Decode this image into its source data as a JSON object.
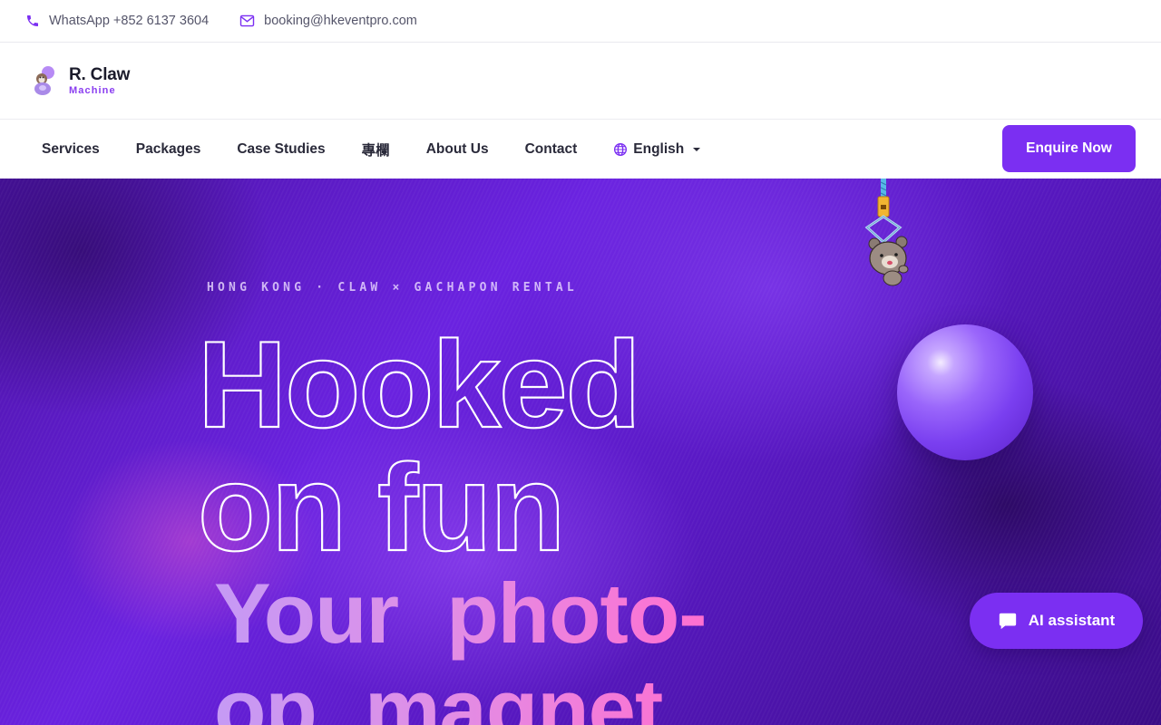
{
  "topbar": {
    "whatsapp": "WhatsApp +852 6137 3604",
    "email": "booking@hkeventpro.com"
  },
  "brand": {
    "name": "R. Claw",
    "sub": "Machine"
  },
  "nav": {
    "items": [
      {
        "label": "Services"
      },
      {
        "label": "Packages"
      },
      {
        "label": "Case Studies"
      },
      {
        "label": "專欄"
      },
      {
        "label": "About Us"
      },
      {
        "label": "Contact"
      }
    ],
    "language": "English",
    "cta": "Enquire Now"
  },
  "hero": {
    "eyebrow": "HONG KONG · CLAW × GACHAPON RENTAL",
    "headline_line1": "Hooked",
    "headline_line2": "on fun",
    "sub_word1": "Your",
    "sub_word2": "photo-",
    "sub_line2_word1": "op",
    "sub_line2_word2": "magnet"
  },
  "assistant": {
    "label": "AI assistant"
  },
  "colors": {
    "accent": "#7b2ff2",
    "brand_sub": "#8a3ef0"
  },
  "icons": [
    "phone-icon",
    "mail-icon",
    "globe-icon",
    "chat-icon",
    "claw-icon",
    "bear-plush-icon",
    "logo-icon"
  ]
}
